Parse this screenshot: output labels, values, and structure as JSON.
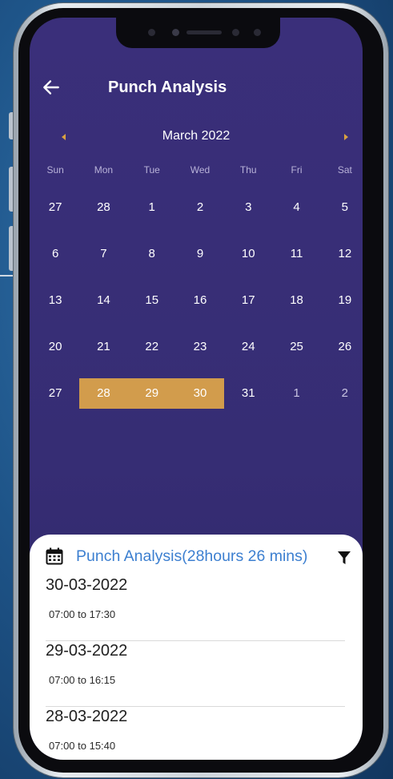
{
  "header": {
    "title": "Punch Analysis"
  },
  "calendar": {
    "month_label": "March 2022",
    "weekdays": [
      "Sun",
      "Mon",
      "Tue",
      "Wed",
      "Thu",
      "Fri",
      "Sat"
    ],
    "weeks": [
      [
        "27",
        "28",
        "1",
        "2",
        "3",
        "4",
        "5"
      ],
      [
        "6",
        "7",
        "8",
        "9",
        "10",
        "11",
        "12"
      ],
      [
        "13",
        "14",
        "15",
        "16",
        "17",
        "18",
        "19"
      ],
      [
        "20",
        "21",
        "22",
        "23",
        "24",
        "25",
        "26"
      ],
      [
        "27",
        "28",
        "29",
        "30",
        "31",
        "1",
        "2"
      ]
    ],
    "selected_range": [
      "28",
      "29",
      "30"
    ]
  },
  "summary": {
    "title": "Punch Analysis(28hours 26 mins)",
    "entries": [
      {
        "date": "30-03-2022",
        "time": "07:00 to 17:30"
      },
      {
        "date": "29-03-2022",
        "time": "07:00 to 16:15"
      },
      {
        "date": "28-03-2022",
        "time": "07:00 to 15:40"
      }
    ]
  },
  "colors": {
    "screen_bg": "#3a2f7a",
    "accent": "#d29c4c",
    "link": "#3c7fd0"
  },
  "icons": [
    "back-arrow-icon",
    "chevron-left-icon",
    "chevron-right-icon",
    "calendar-icon",
    "filter-icon"
  ]
}
